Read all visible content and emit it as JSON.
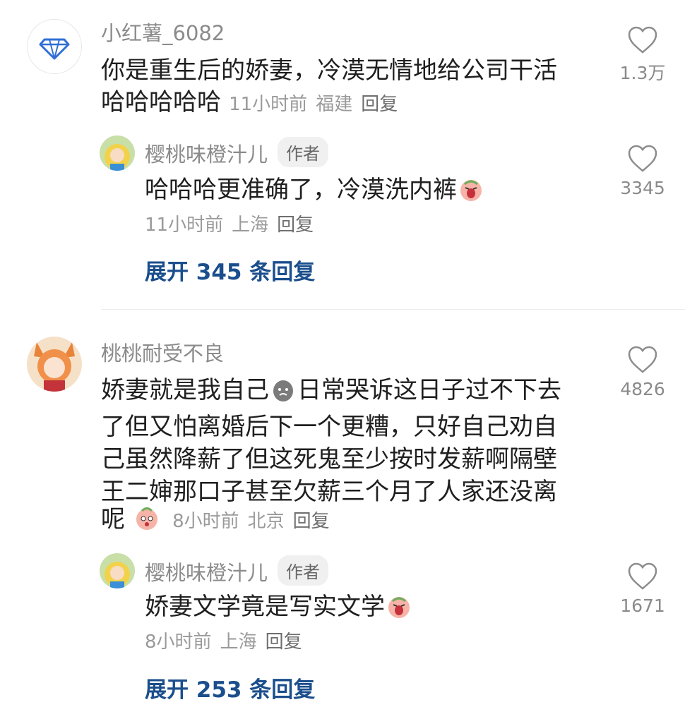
{
  "comments": [
    {
      "username": "小红薯_6082",
      "text_line1": "你是重生后的娇妻，冷漠无情地给公司干活",
      "text_line2": "哈哈哈哈哈",
      "time": "11小时前",
      "location": "福建",
      "reply_label": "回复",
      "likes": "1.3万",
      "avatar_icon": "diamond-icon"
    },
    {
      "username": "樱桃味橙汁儿",
      "badge": "作者",
      "text": "哈哈哈更准确了，冷漠洗内裤",
      "emoji": "crying-emoji",
      "time": "11小时前",
      "location": "上海",
      "reply_label": "回复",
      "likes": "3345"
    },
    {
      "expand_label": "展开 345 条回复"
    },
    {
      "username": "桃桃耐受不良",
      "text_line1": "娇妻就是我自己",
      "text_line1b": "日常哭诉这日子过不下去",
      "text_line2": "了但又怕离婚后下一个更糟，只好自己劝自",
      "text_line3": "己虽然降薪了但这死鬼至少按时发薪啊隔壁",
      "text_line4": "王二婶那口子甚至欠薪三个月了人家还没离",
      "text_line5": "呢",
      "emoji_inline": "sad-bean-emoji",
      "emoji_end": "peach-emoji",
      "time": "8小时前",
      "location": "北京",
      "reply_label": "回复",
      "likes": "4826"
    },
    {
      "username": "樱桃味橙汁儿",
      "badge": "作者",
      "text": "娇妻文学竟是写实文学",
      "emoji": "crying-emoji",
      "time": "8小时前",
      "location": "上海",
      "reply_label": "回复",
      "likes": "1671"
    },
    {
      "expand_label": "展开 253 条回复"
    }
  ],
  "colors": {
    "expand": "#1b4e8c",
    "username": "#8b8b8b",
    "meta": "#9a9a9a"
  }
}
